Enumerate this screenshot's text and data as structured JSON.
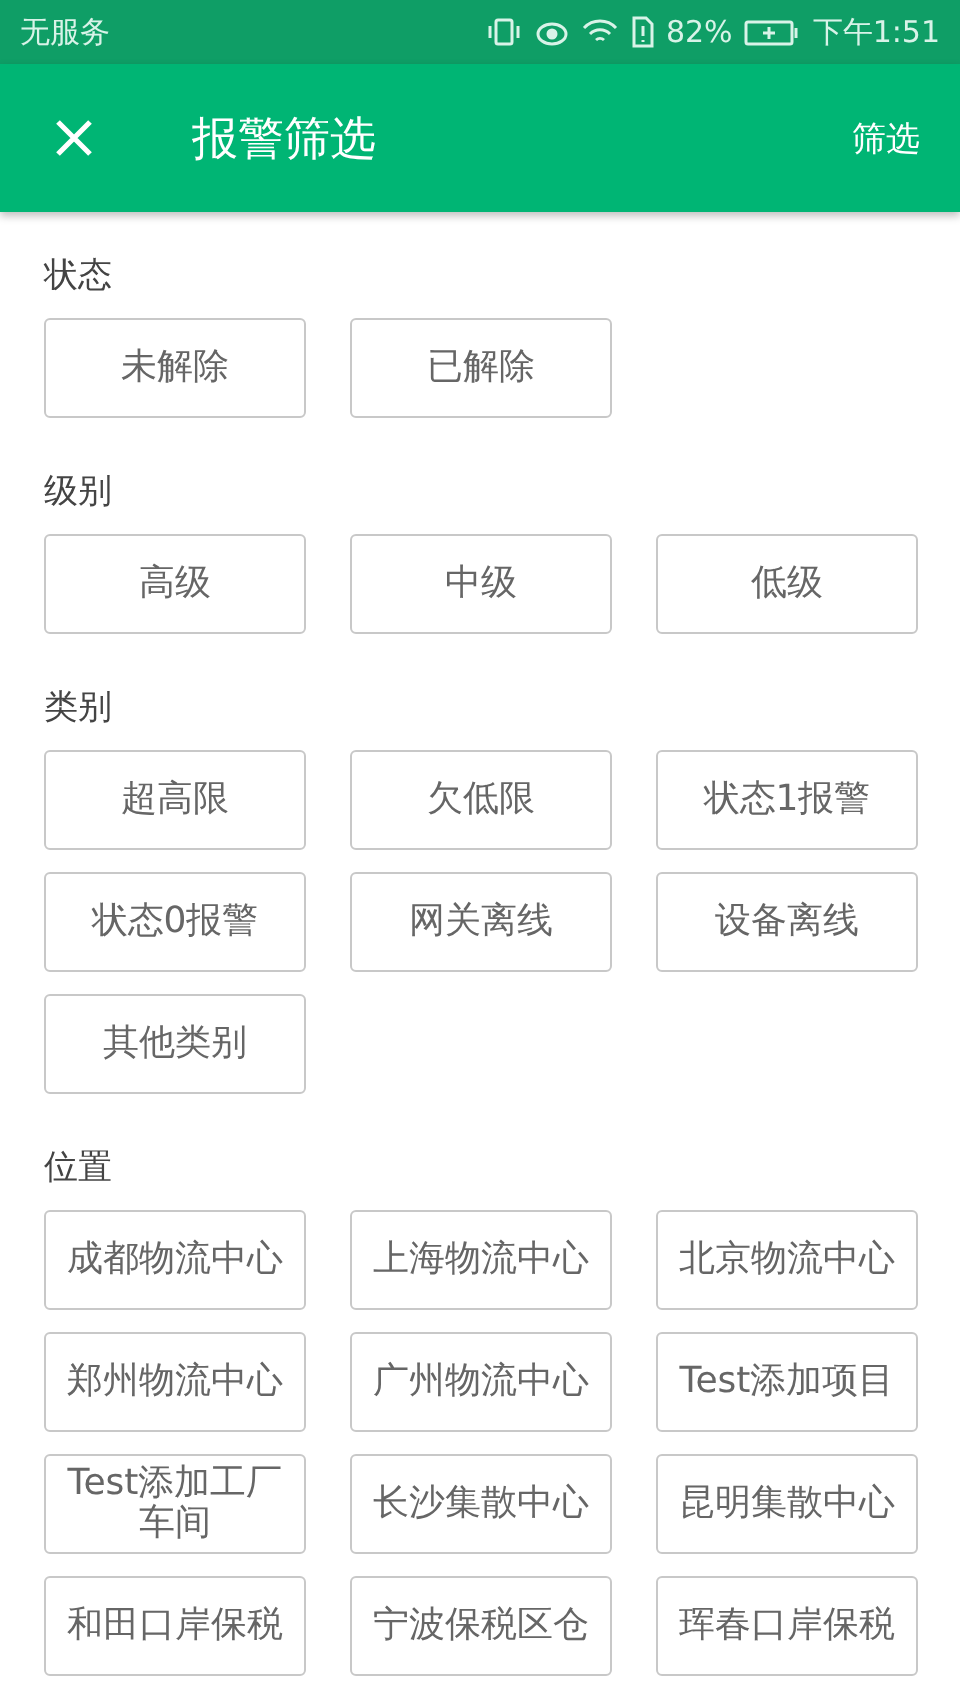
{
  "status_bar": {
    "carrier": "无服务",
    "battery": "82%",
    "time": "下午1:51"
  },
  "app_bar": {
    "title": "报警筛选",
    "action": "筛选"
  },
  "sections": [
    {
      "title": "状态",
      "options": [
        "未解除",
        "已解除"
      ]
    },
    {
      "title": "级别",
      "options": [
        "高级",
        "中级",
        "低级"
      ]
    },
    {
      "title": "类别",
      "options": [
        "超高限",
        "欠低限",
        "状态1报警",
        "状态0报警",
        "网关离线",
        "设备离线",
        "其他类别"
      ]
    },
    {
      "title": "位置",
      "options": [
        "成都物流中心",
        "上海物流中心",
        "北京物流中心",
        "郑州物流中心",
        "广州物流中心",
        "Test添加项目",
        "Test添加工厂车间",
        "长沙集散中心",
        "昆明集散中心",
        "和田口岸保税",
        "宁波保税区仓",
        "珲春口岸保税"
      ]
    }
  ]
}
